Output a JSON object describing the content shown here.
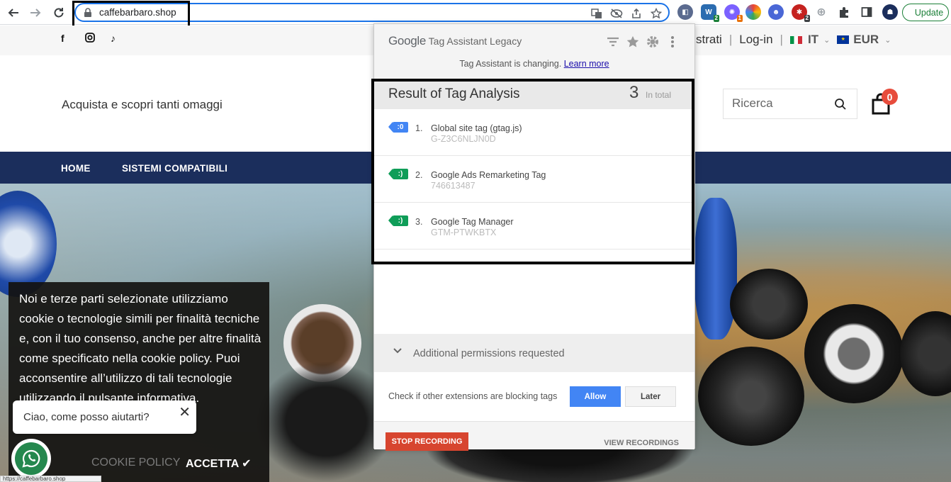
{
  "browser": {
    "url": "caffebarbaro.shop",
    "update_label": "Update",
    "extension_badges": [
      "2",
      "1",
      "2"
    ]
  },
  "site": {
    "top_links": {
      "register_partial": "strati",
      "login": "Log-in",
      "language": "IT",
      "currency": "EUR"
    },
    "tagline": "Acquista e scopri tanti omaggi",
    "search_placeholder": "Ricerca",
    "cart_count": "0",
    "nav": {
      "home": "HOME",
      "systems": "SISTEMI COMPATIBILI"
    }
  },
  "cookie_banner": {
    "text": "Noi e terze parti selezionate utilizziamo cookie o tecnologie simili per finalità tecniche e, con il tuo consenso, anche per altre finalità come specificato nella cookie policy. Puoi acconsentire all’utilizzo di tali tecnologie utilizzando il pulsante",
    "text_tail": "informativa.",
    "policy_label": "COOKIE POLICY",
    "accept_label": "ACCETTA ✔"
  },
  "chat": {
    "prompt": "Ciao, come posso aiutarti?",
    "close": "✕"
  },
  "status_url": "https://caffebarbaro.shop",
  "tag_assistant": {
    "brand": "Google",
    "title": "Tag Assistant Legacy",
    "notice": "Tag Assistant is changing.",
    "learn_more": "Learn more",
    "result_title": "Result of Tag Analysis",
    "count": "3",
    "count_label": "In total",
    "tags": [
      {
        "num": "1.",
        "name": "Global site tag (gtag.js)",
        "id": "G-Z3C6NLJN0D",
        "icon": ":0",
        "color": "#4285f4"
      },
      {
        "num": "2.",
        "name": "Google Ads Remarketing Tag",
        "id": "746613487",
        "icon": ":)",
        "color": "#0f9d58"
      },
      {
        "num": "3.",
        "name": "Google Tag Manager",
        "id": "GTM-PTWKBTX",
        "icon": ":)",
        "color": "#0f9d58"
      }
    ],
    "permissions_label": "Additional permissions requested",
    "check_text": "Check if other extensions are blocking tags",
    "allow_label": "Allow",
    "later_label": "Later",
    "stop_label": "STOP RECORDING",
    "view_label": "VIEW RECORDINGS"
  }
}
